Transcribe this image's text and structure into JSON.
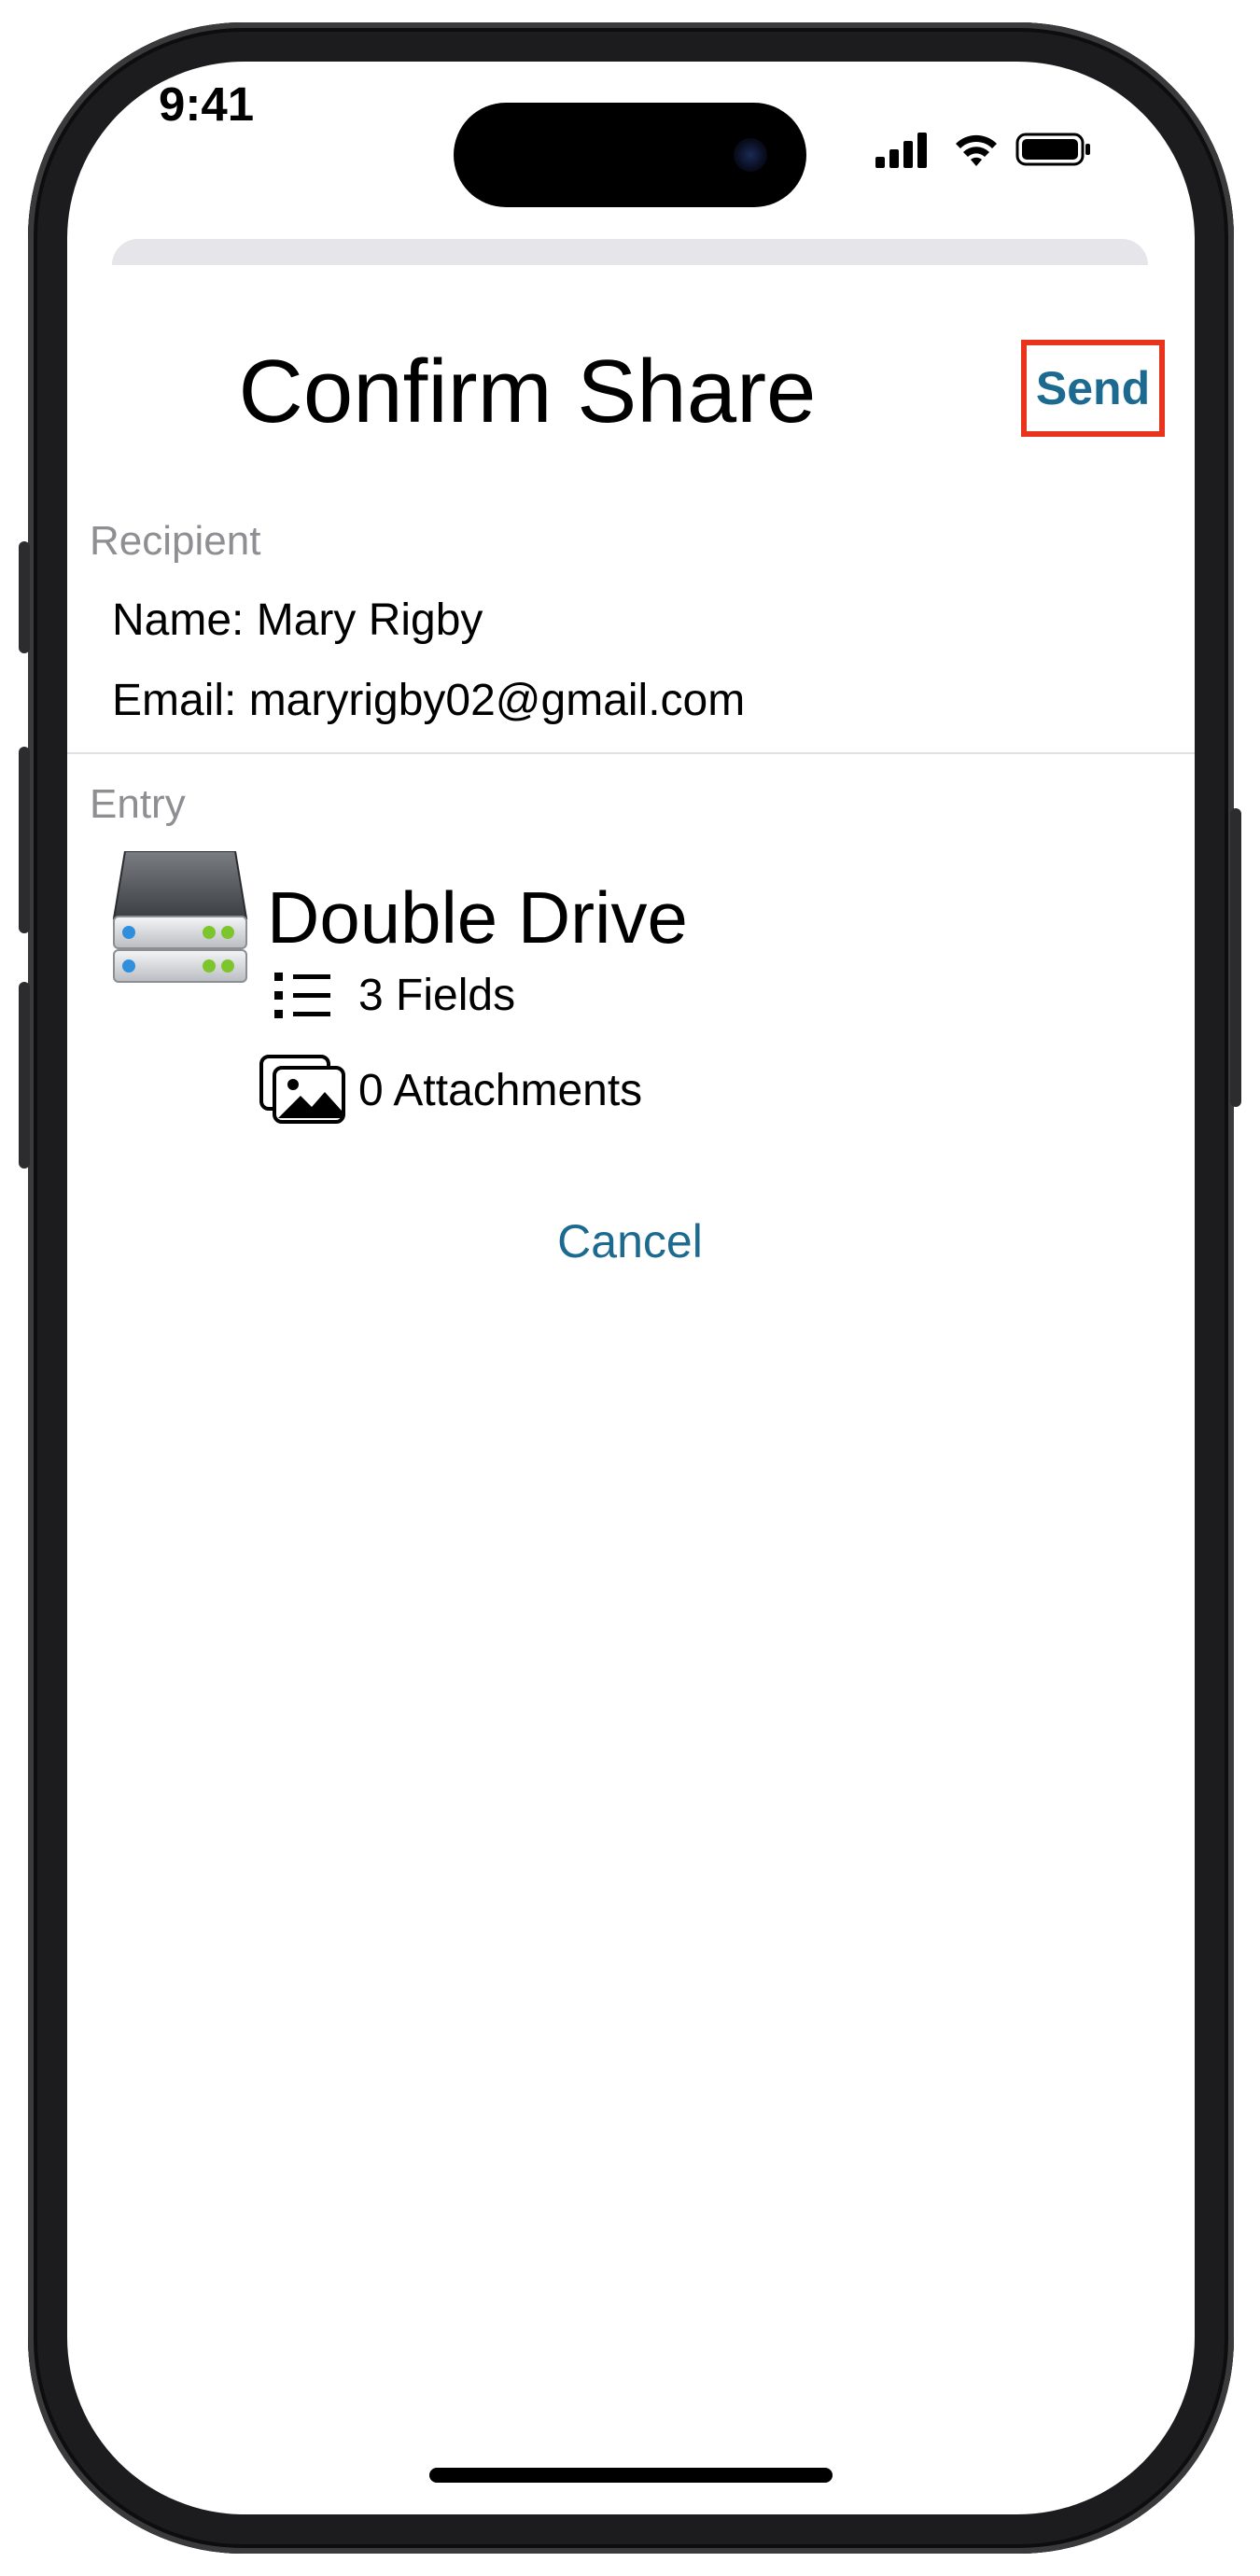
{
  "status_bar": {
    "time": "9:41"
  },
  "header": {
    "title": "Confirm Share",
    "send_label": "Send"
  },
  "recipient": {
    "section_label": "Recipient",
    "name_line": "Name: Mary Rigby",
    "email_line": "Email: maryrigby02@gmail.com"
  },
  "entry": {
    "section_label": "Entry",
    "title": "Double Drive",
    "icon": "drive-icon",
    "fields_line": "3 Fields",
    "attachments_line": "0 Attachments"
  },
  "cancel_label": "Cancel",
  "colors": {
    "accent": "#1d6a91",
    "highlight_box": "#e8341c",
    "secondary_text": "#8e8e93"
  }
}
